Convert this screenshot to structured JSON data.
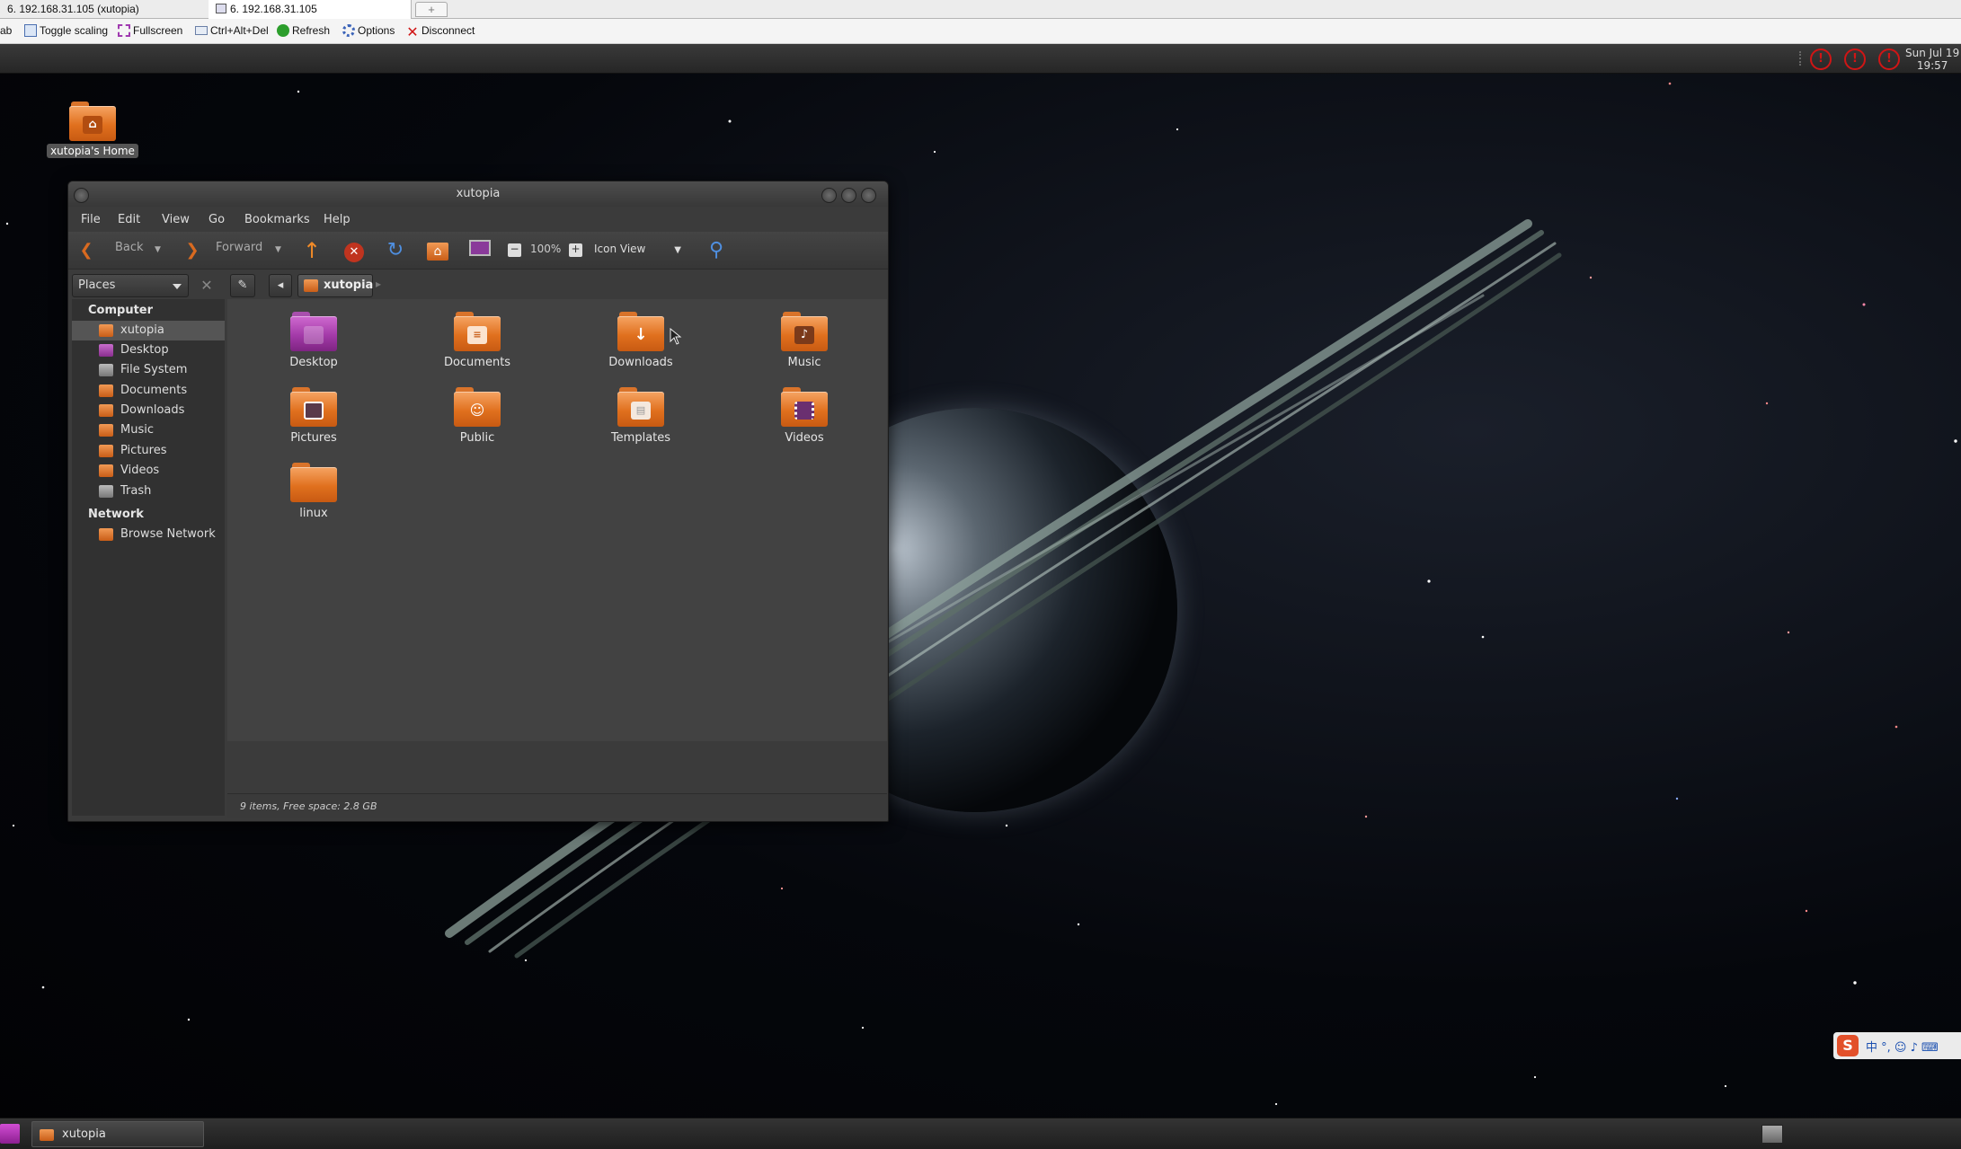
{
  "browser": {
    "tabs": [
      {
        "label": "6. 192.168.31.105 (xutopia)"
      },
      {
        "label": "6. 192.168.31.105"
      }
    ],
    "new_tab_glyph": "+",
    "toolbar": {
      "partial_left": "ab",
      "toggle_scaling": "Toggle scaling",
      "fullscreen": "Fullscreen",
      "ctrl_alt_del": "Ctrl+Alt+Del",
      "refresh": "Refresh",
      "options": "Options",
      "disconnect": "Disconnect"
    }
  },
  "desktop": {
    "clock_line1": "Sun Jul 19",
    "clock_line2": "19:57",
    "home_icon_label": "xutopia's Home",
    "tray_icons": [
      "alert-icon",
      "alert-icon",
      "alert-icon"
    ]
  },
  "window": {
    "title": "xutopia",
    "menu": [
      "File",
      "Edit",
      "View",
      "Go",
      "Bookmarks",
      "Help"
    ],
    "toolbar": {
      "back": "Back",
      "forward": "Forward",
      "zoom": "100%",
      "view_mode": "Icon View"
    },
    "places_combo": "Places",
    "sidebar": {
      "sections": [
        {
          "title": "Computer",
          "items": [
            {
              "label": "xutopia",
              "selected": true
            },
            {
              "label": "Desktop"
            },
            {
              "label": "File System"
            },
            {
              "label": "Documents"
            },
            {
              "label": "Downloads"
            },
            {
              "label": "Music"
            },
            {
              "label": "Pictures"
            },
            {
              "label": "Videos"
            },
            {
              "label": "Trash"
            }
          ]
        },
        {
          "title": "Network",
          "items": [
            {
              "label": "Browse Network"
            }
          ]
        }
      ]
    },
    "breadcrumb": "xutopia",
    "files": [
      {
        "name": "Desktop",
        "icon": "desktop-folder-icon"
      },
      {
        "name": "Documents",
        "icon": "documents-folder-icon"
      },
      {
        "name": "Downloads",
        "icon": "downloads-folder-icon"
      },
      {
        "name": "Music",
        "icon": "music-folder-icon"
      },
      {
        "name": "Pictures",
        "icon": "pictures-folder-icon"
      },
      {
        "name": "Public",
        "icon": "public-folder-icon"
      },
      {
        "name": "Templates",
        "icon": "templates-folder-icon"
      },
      {
        "name": "Videos",
        "icon": "videos-folder-icon"
      },
      {
        "name": "linux",
        "icon": "folder-icon"
      }
    ],
    "status": "9 items, Free space: 2.8 GB"
  },
  "ime": {
    "logo": "S",
    "text": "中 °, ☺ ♪ ⌨"
  },
  "taskbar": {
    "window_button": "xutopia"
  },
  "colors": {
    "folder_orange": "#e0701e",
    "desktop_folder_purple": "#a33aa8",
    "alert_red": "#d01515",
    "window_bg": "#3b3b3b"
  }
}
